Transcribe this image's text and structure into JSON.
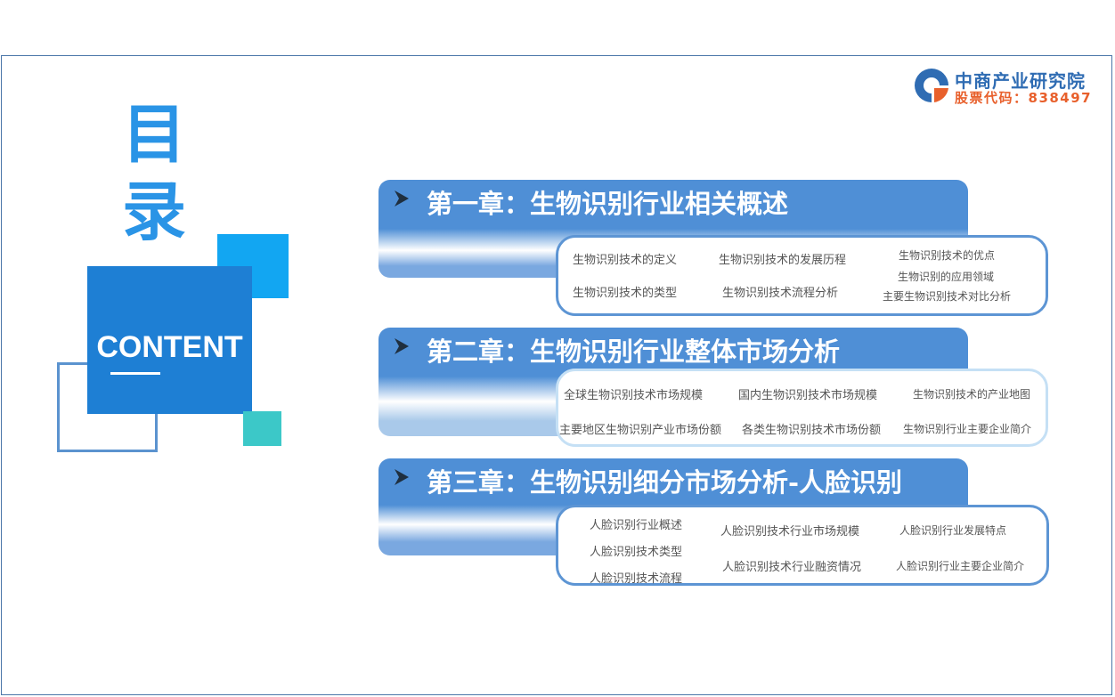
{
  "logo": {
    "name": "中商产业研究院",
    "stock_code": "股票代码：838497",
    "colors": {
      "blue": "#2f6cb3",
      "orange": "#e8602c"
    }
  },
  "title": {
    "chars": [
      "目",
      "录"
    ],
    "content_label": "CONTENT"
  },
  "chapters": [
    {
      "title": "第一章：生物识别行业相关概述",
      "items": [
        "生物识别技术的定义",
        "生物识别技术的发展历程",
        "生物识别技术的优点",
        "生物识别的应用领域",
        "生物识别技术的类型",
        "生物识别技术流程分析",
        "主要生物识别技术对比分析"
      ]
    },
    {
      "title": "第二章：生物识别行业整体市场分析",
      "items": [
        "全球生物识别技术市场规模",
        "国内生物识别技术市场规模",
        "生物识别技术的产业地图",
        "主要地区生物识别产业市场份额",
        "各类生物识别技术市场份额",
        "生物识别行业主要企业简介"
      ]
    },
    {
      "title": "第三章：生物识别细分市场分析-人脸识别",
      "items": [
        "人脸识别行业概述",
        "人脸识别技术行业市场规模",
        "人脸识别行业发展特点",
        "人脸识别技术类型",
        "人脸识别技术流程",
        "人脸识别技术行业融资情况",
        "人脸识别行业主要企业简介"
      ]
    }
  ],
  "colors": {
    "title_blue": "#2a94e6",
    "main_square": "#1e7fd4",
    "light_square": "#12a6f2",
    "teal_square": "#3cc8c8",
    "chapter_blue": "#4f8fd6"
  }
}
